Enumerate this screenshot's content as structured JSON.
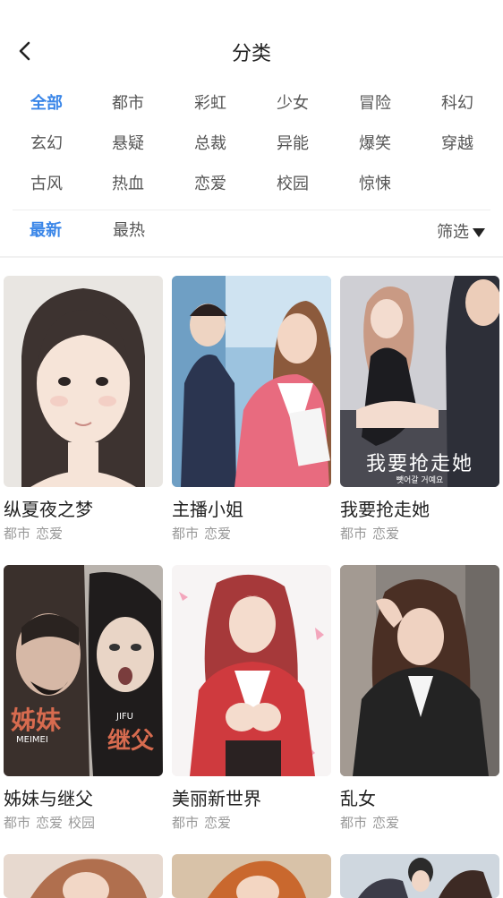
{
  "header": {
    "title": "分类"
  },
  "categories": [
    "全部",
    "都市",
    "彩虹",
    "少女",
    "冒险",
    "科幻",
    "玄幻",
    "悬疑",
    "总裁",
    "异能",
    "爆笑",
    "穿越",
    "古风",
    "热血",
    "恋爱",
    "校园",
    "惊悚"
  ],
  "sort": {
    "latest": "最新",
    "hottest": "最热",
    "filter": "筛选"
  },
  "comics": [
    {
      "title": "纵夏夜之梦",
      "tags": [
        "都市",
        "恋爱"
      ]
    },
    {
      "title": "主播小姐",
      "tags": [
        "都市",
        "恋爱"
      ]
    },
    {
      "title": "我要抢走她",
      "tags": [
        "都市",
        "恋爱"
      ],
      "cover_text": "我要抢走她",
      "cover_subtext": "뺏어갈 거예요"
    },
    {
      "title": "姊妹与继父",
      "tags": [
        "都市",
        "恋爱",
        "校园"
      ],
      "cover_logo_left": "姊妹",
      "cover_logo_left_sub": "MEIMEI",
      "cover_logo_right": "继父",
      "cover_logo_right_sub": "JIFU"
    },
    {
      "title": "美丽新世界",
      "tags": [
        "都市",
        "恋爱"
      ]
    },
    {
      "title": "乱女",
      "tags": [
        "都市",
        "恋爱"
      ]
    }
  ],
  "colors": {
    "accent": "#3a86e8",
    "text": "#222222",
    "muted": "#999999"
  }
}
